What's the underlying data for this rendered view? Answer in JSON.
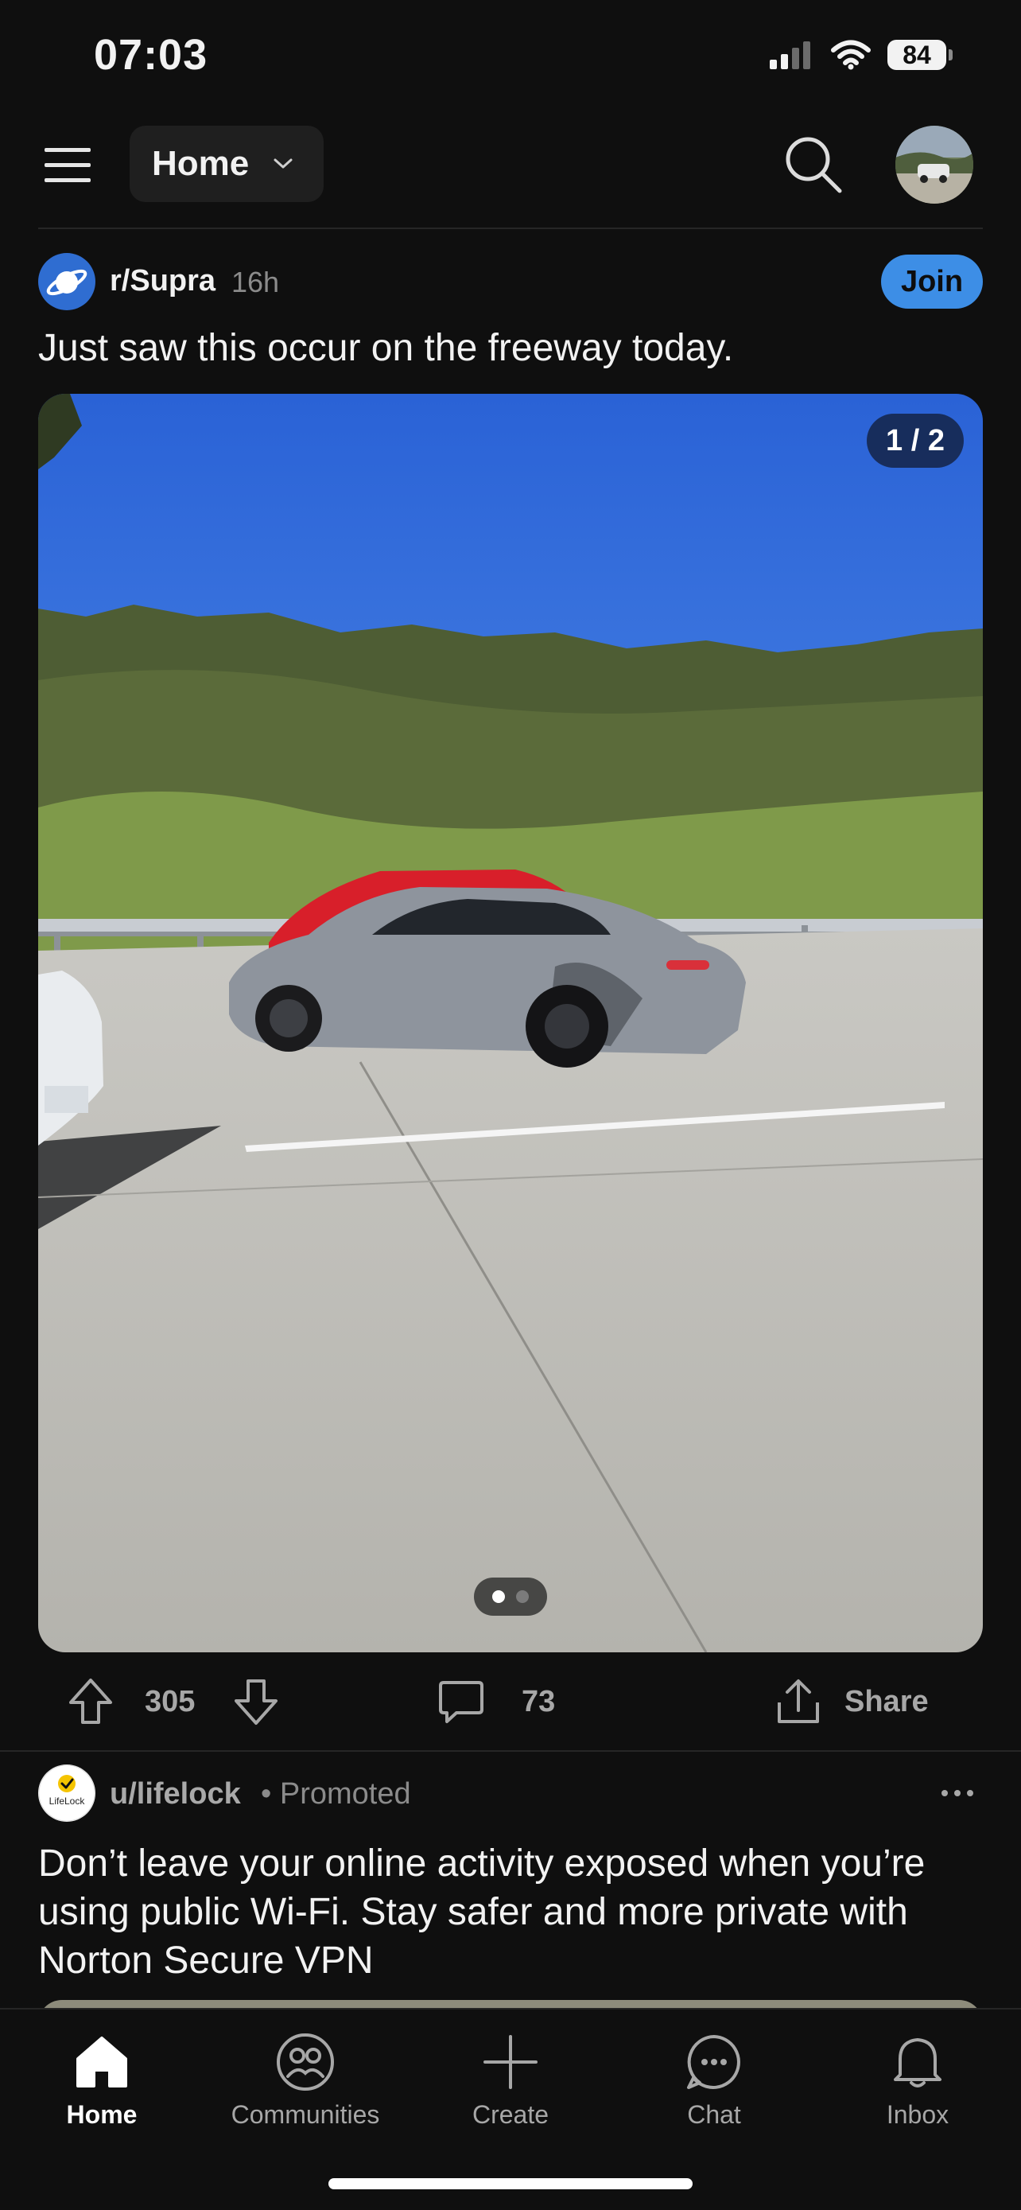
{
  "status_bar": {
    "time": "07:03",
    "battery": "84",
    "icons": [
      "cellular-signal-icon",
      "wifi-icon",
      "battery-icon"
    ]
  },
  "top_bar": {
    "feed_selector": "Home",
    "icons": [
      "menu-icon",
      "chevron-down-icon",
      "search-icon",
      "avatar"
    ]
  },
  "post": {
    "subreddit": "r/Supra",
    "age": "16h",
    "join_label": "Join",
    "title": "Just saw this occur on the freeway today.",
    "gallery_counter": "1 / 2",
    "gallery_index": 1,
    "gallery_total": 2,
    "upvotes": "305",
    "comments": "73",
    "share_label": "Share"
  },
  "promoted_post": {
    "user": "u/lifelock",
    "tag": "• Promoted",
    "title": "Don’t leave your online activity exposed when you’re using public Wi-Fi. Stay safer and more private with Norton Secure VPN",
    "icon_text": "LifeLock"
  },
  "bottom_nav": {
    "items": [
      {
        "label": "Home",
        "icon": "home-icon",
        "active": true
      },
      {
        "label": "Communities",
        "icon": "communities-icon",
        "active": false
      },
      {
        "label": "Create",
        "icon": "plus-icon",
        "active": false
      },
      {
        "label": "Chat",
        "icon": "chat-icon",
        "active": false
      },
      {
        "label": "Inbox",
        "icon": "bell-icon",
        "active": false
      }
    ]
  },
  "colors": {
    "background": "#0f0f0f",
    "join_button": "#3d8ee6",
    "secondary_text": "#8b8b8b"
  }
}
